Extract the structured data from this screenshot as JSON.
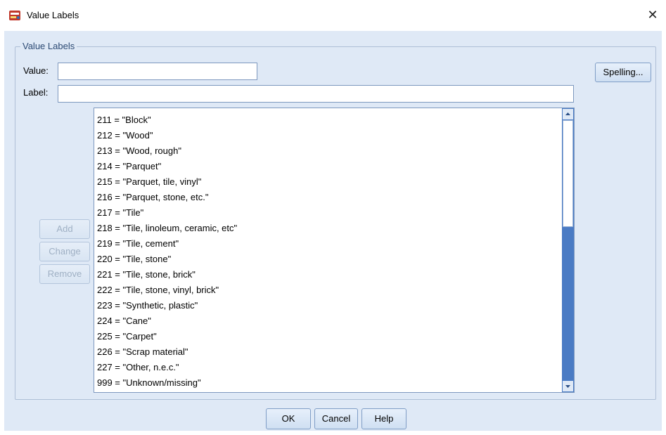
{
  "window": {
    "title": "Value Labels",
    "close_glyph": "✕"
  },
  "group": {
    "legend": "Value Labels"
  },
  "fields": {
    "value_label": "Value:",
    "value_value": "",
    "label_label": "Label:",
    "label_value": ""
  },
  "buttons": {
    "spelling": "Spelling...",
    "add": "Add",
    "change": "Change",
    "remove": "Remove",
    "ok": "OK",
    "cancel": "Cancel",
    "help": "Help"
  },
  "value_labels": [
    "211 = \"Block\"",
    "212 = \"Wood\"",
    "213 = \"Wood, rough\"",
    "214 = \"Parquet\"",
    "215 = \"Parquet, tile, vinyl\"",
    "216 = \"Parquet, stone, etc.\"",
    "217 = \"Tile\"",
    "218 = \"Tile, linoleum, ceramic, etc\"",
    "219 = \"Tile, cement\"",
    "220 = \"Tile, stone\"",
    "221 = \"Tile, stone, brick\"",
    "222 = \"Tile, stone, vinyl, brick\"",
    "223 = \"Synthetic, plastic\"",
    "224 = \"Cane\"",
    "225 = \"Carpet\"",
    "226 = \"Scrap material\"",
    "227 = \"Other, n.e.c.\"",
    "999 = \"Unknown/missing\""
  ],
  "colors": {
    "client_bg": "#dfe9f6",
    "scrollbar_track": "#4a7bc4",
    "disabled_text": "#9fb0c4"
  },
  "icons": {
    "app": "value-labels-app-icon",
    "close": "close-icon",
    "scroll_up": "scroll-up-arrow-icon",
    "scroll_down": "scroll-down-arrow-icon"
  }
}
